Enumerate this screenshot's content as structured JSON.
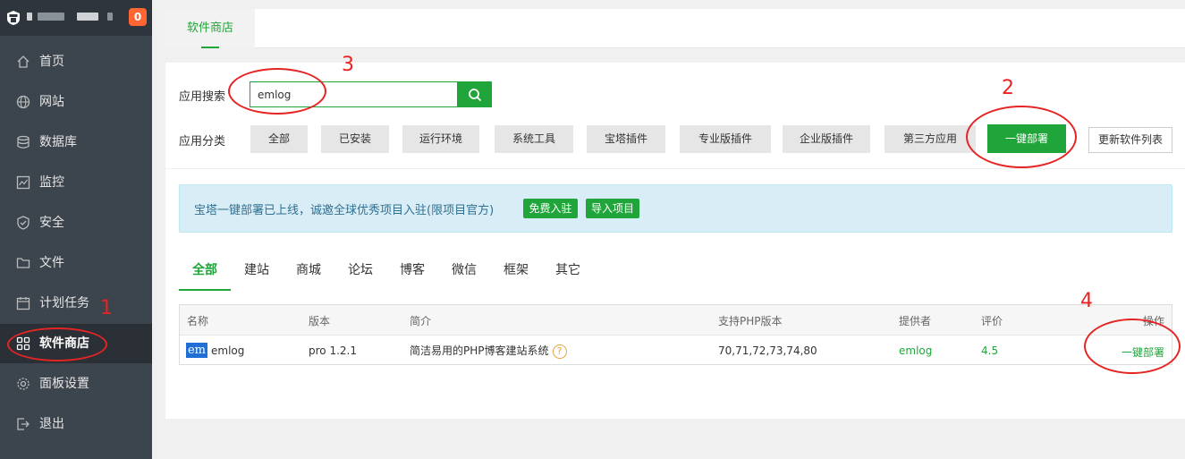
{
  "sidebar": {
    "badge": "0",
    "items": [
      {
        "label": "首页",
        "icon": "home-icon"
      },
      {
        "label": "网站",
        "icon": "globe-icon"
      },
      {
        "label": "数据库",
        "icon": "database-icon"
      },
      {
        "label": "监控",
        "icon": "monitor-icon"
      },
      {
        "label": "安全",
        "icon": "shield-icon"
      },
      {
        "label": "文件",
        "icon": "folder-icon"
      },
      {
        "label": "计划任务",
        "icon": "calendar-icon"
      },
      {
        "label": "软件商店",
        "icon": "grid-icon"
      },
      {
        "label": "面板设置",
        "icon": "gear-icon"
      },
      {
        "label": "退出",
        "icon": "logout-icon"
      }
    ],
    "active_index": 7
  },
  "tabbar": {
    "tab": "软件商店"
  },
  "search": {
    "label": "应用搜索",
    "value": "emlog"
  },
  "category": {
    "label": "应用分类",
    "buttons": [
      "全部",
      "已安装",
      "运行环境",
      "系统工具",
      "宝塔插件",
      "专业版插件",
      "企业版插件",
      "第三方应用"
    ],
    "deploy": "一键部署",
    "refresh": "更新软件列表"
  },
  "notice": {
    "text": "宝塔一键部署已上线，诚邀全球优秀项目入驻(限项目官方)",
    "btn_join": "免费入驻",
    "btn_import": "导入项目"
  },
  "type_tabs": [
    "全部",
    "建站",
    "商城",
    "论坛",
    "博客",
    "微信",
    "框架",
    "其它"
  ],
  "table": {
    "headers": [
      "名称",
      "版本",
      "简介",
      "支持PHP版本",
      "提供者",
      "评价",
      "操作"
    ],
    "row": {
      "logo": "em",
      "name": "emlog",
      "version": "pro 1.2.1",
      "desc": "简洁易用的PHP博客建站系统",
      "help": "?",
      "php": "70,71,72,73,74,80",
      "provider": "emlog",
      "rating": "4.5",
      "action": "一键部署"
    }
  },
  "annotations": [
    "1",
    "2",
    "3",
    "4"
  ],
  "colors": {
    "accent": "#20a53a",
    "sidebar": "#3c444d",
    "annotation": "#e52424",
    "badge": "#ff6633"
  }
}
